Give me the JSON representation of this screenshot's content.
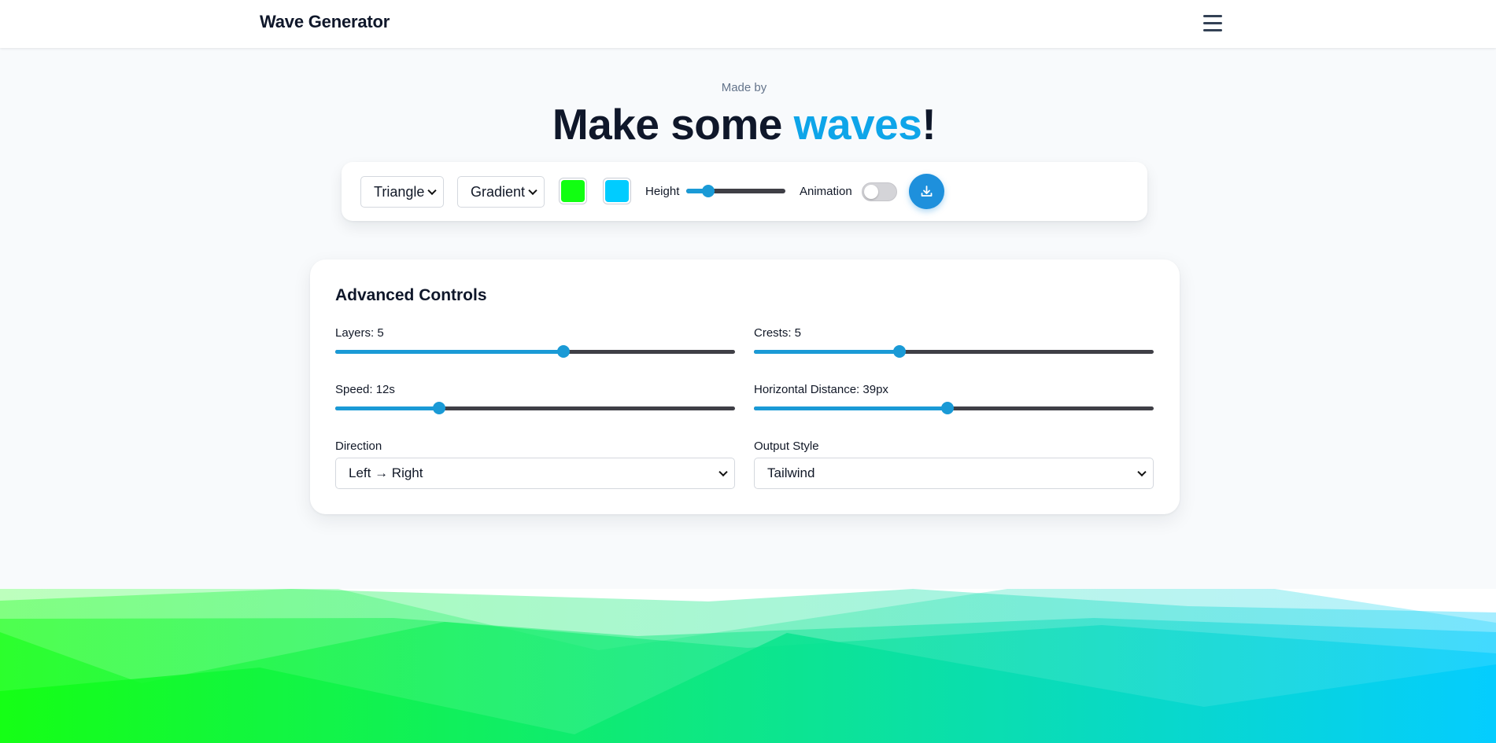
{
  "header": {
    "brand": "Wave Generator",
    "menu_icon": "hamburger-menu-icon"
  },
  "hero": {
    "made_by": "Made by",
    "headline_part1": "Make some ",
    "headline_accent": "waves",
    "headline_end": "!",
    "accent_color": "#0ea5e9"
  },
  "toolbar": {
    "shape_select": "Triangle",
    "fill_select": "Gradient",
    "color1": "#11ff11",
    "color2": "#00ccff",
    "height_label": "Height",
    "height_value_fraction": 0.22,
    "animation_label": "Animation",
    "animation_on": false,
    "download_icon": "download-icon"
  },
  "advanced": {
    "title": "Advanced Controls",
    "layers_label": "Layers: 5",
    "layers_fraction": 0.57,
    "crests_label": "Crests: 5",
    "crests_fraction": 0.365,
    "speed_label": "Speed: 12s",
    "speed_fraction": 0.26,
    "hdist_label": "Horizontal Distance: 39px",
    "hdist_fraction": 0.485,
    "direction_label": "Direction",
    "direction_value": "Left → Right",
    "output_label": "Output Style",
    "output_value": "Tailwind"
  },
  "wave_preview": {
    "layers": 5,
    "crests": 5,
    "gradient_from": "#11ff11",
    "gradient_to": "#00ccff"
  }
}
